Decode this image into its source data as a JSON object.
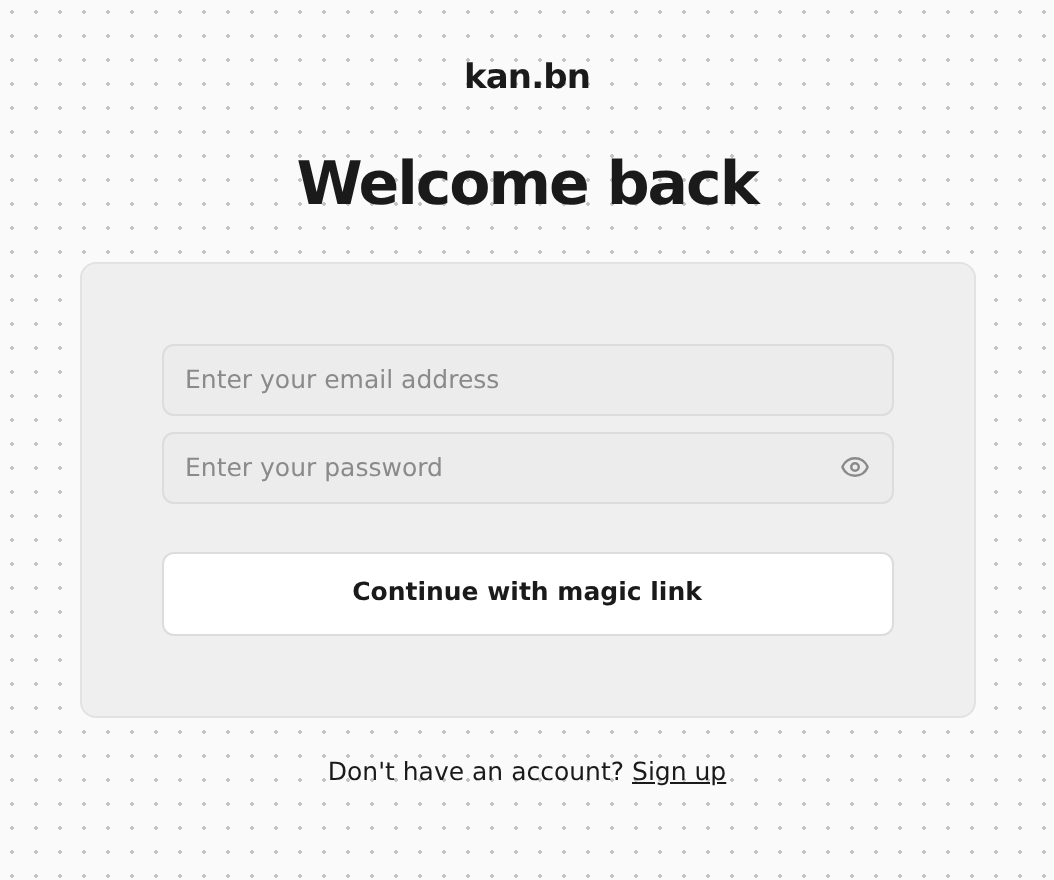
{
  "logo": "kan.bn",
  "heading": "Welcome back",
  "form": {
    "email": {
      "placeholder": "Enter your email address"
    },
    "password": {
      "placeholder": "Enter your password"
    },
    "submit": "Continue with magic link"
  },
  "footer": {
    "text": "Don't have an account?",
    "link": "Sign up"
  }
}
